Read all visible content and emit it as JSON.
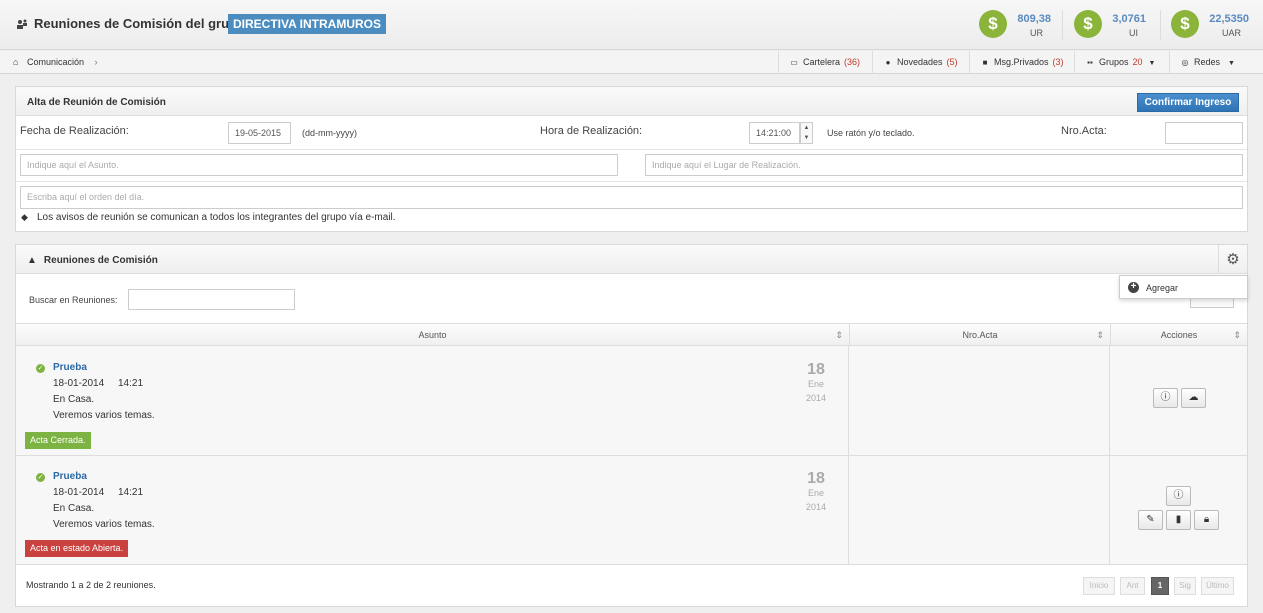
{
  "header": {
    "title": "Reuniones de Comisión del grupo",
    "group": "DIRECTIVA INTRAMUROS",
    "currencies": [
      {
        "value": "809,38",
        "unit": "UR"
      },
      {
        "value": "3,0761",
        "unit": "UI"
      },
      {
        "value": "22,5350",
        "unit": "UAR"
      }
    ],
    "currency_color": "#8ab43a"
  },
  "nav": {
    "breadcrumb": "Comunicación",
    "items": [
      {
        "label": "Cartelera",
        "count": "(36)",
        "icon": "board-icon"
      },
      {
        "label": "Novedades",
        "count": "(5)",
        "icon": "news-icon"
      },
      {
        "label": "Msg.Privados",
        "count": "(3)",
        "icon": "lock-icon"
      },
      {
        "label": "Grupos",
        "count": "20",
        "icon": "grid-icon"
      },
      {
        "label": "Redes",
        "count": "",
        "icon": "network-icon"
      }
    ]
  },
  "form": {
    "title": "Alta de Reunión de Comisión",
    "confirm": "Confirmar Ingreso",
    "date_label": "Fecha de Realización:",
    "date_value": "19-05-2015",
    "date_hint": "(dd-mm-yyyy)",
    "time_label": "Hora de Realización:",
    "time_value": "14:21:00",
    "time_hint": "Use ratón y/o teclado.",
    "acta_label": "Nro.Acta:",
    "acta_value": "",
    "subject_placeholder": "Indique aquí el Asunto.",
    "place_placeholder": "Indique aquí el Lugar de Realización.",
    "agenda_placeholder": "Escriba aquí el orden del día.",
    "note": "Los avisos de reunión se comunican a todos los integrantes del grupo vía e-mail."
  },
  "list": {
    "title": "Reuniones de Comisión",
    "search_label": "Buscar en Reuniones:",
    "search_value": "",
    "menu_add": "Agregar",
    "columns": [
      "Asunto",
      "Nro.Acta",
      "Acciones"
    ],
    "rows": [
      {
        "title": "Prueba",
        "date": "18-01-2014",
        "time": "14:21",
        "place": "En Casa.",
        "agenda": "Veremos varios temas.",
        "day": "18",
        "month": "Ene",
        "year": "2014",
        "status": "Acta Cerrada.",
        "acta": ""
      },
      {
        "title": "Prueba",
        "date": "18-01-2014",
        "time": "14:21",
        "place": "En Casa.",
        "agenda": "Veremos varios temas.",
        "day": "18",
        "month": "Ene",
        "year": "2014",
        "status": "Acta en estado Abierta.",
        "acta": ""
      }
    ],
    "footer": "Mostrando 1 a 2 de 2 reuniones.",
    "pager": [
      "Inicio",
      "Ant",
      "1",
      "Sig",
      "Último"
    ]
  }
}
